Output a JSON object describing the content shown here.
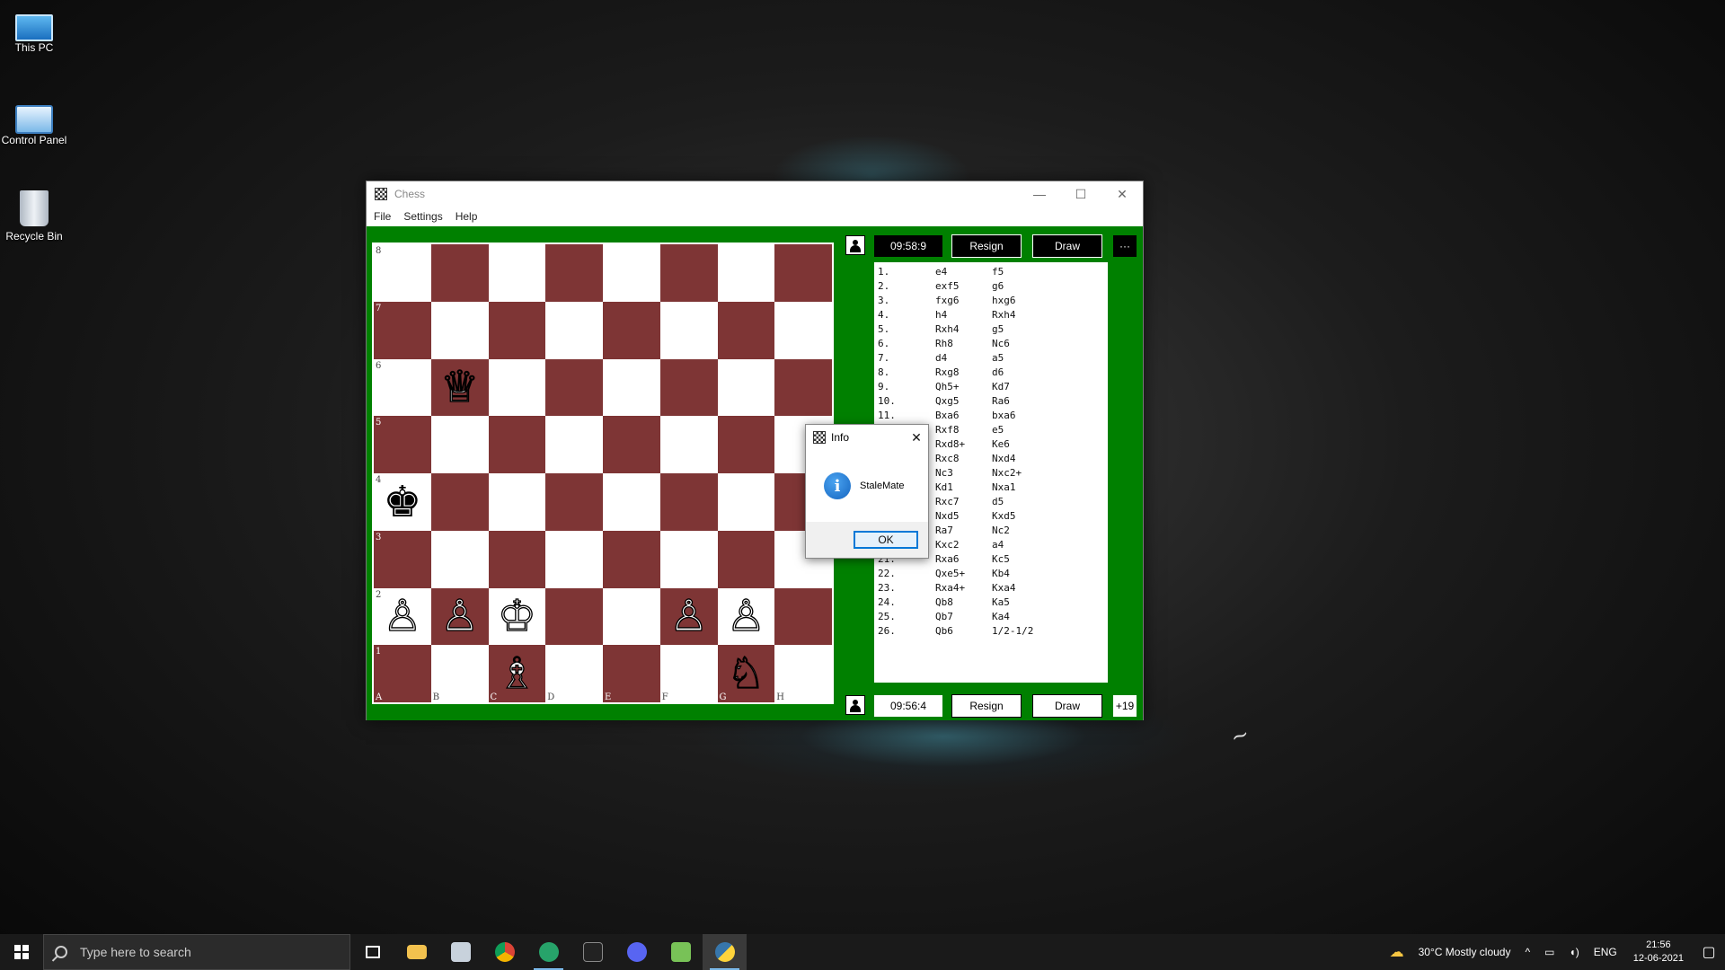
{
  "desktop": {
    "icons": [
      {
        "label": "This PC"
      },
      {
        "label": "Control Panel"
      },
      {
        "label": "Recycle Bin"
      }
    ]
  },
  "window": {
    "title": "Chess",
    "menu": [
      "File",
      "Settings",
      "Help"
    ]
  },
  "board": {
    "ranks": [
      "8",
      "7",
      "6",
      "5",
      "4",
      "3",
      "2",
      "1"
    ],
    "files": [
      "A",
      "B",
      "C",
      "D",
      "E",
      "F",
      "G",
      "H"
    ],
    "colors": {
      "light": "#ffffff",
      "dark": "#7e3535",
      "background": "#008000"
    },
    "pieces": {
      "b6": {
        "glyph": "♕",
        "color": "white",
        "name": "queen"
      },
      "a4": {
        "glyph": "♚",
        "color": "black",
        "name": "king"
      },
      "a2": {
        "glyph": "♙",
        "color": "white",
        "name": "pawn"
      },
      "b2": {
        "glyph": "♙",
        "color": "white",
        "name": "pawn"
      },
      "c2": {
        "glyph": "♔",
        "color": "white",
        "name": "king"
      },
      "f2": {
        "glyph": "♙",
        "color": "white",
        "name": "pawn"
      },
      "g2": {
        "glyph": "♙",
        "color": "white",
        "name": "pawn"
      },
      "c1": {
        "glyph": "♗",
        "color": "white",
        "name": "bishop"
      },
      "g1": {
        "glyph": "♘",
        "color": "white",
        "name": "knight"
      }
    }
  },
  "top_player": {
    "clock": "09:58:9",
    "resign_label": "Resign",
    "draw_label": "Draw",
    "more_label": "···"
  },
  "bottom_player": {
    "clock": "09:56:4",
    "resign_label": "Resign",
    "draw_label": "Draw",
    "material_label": "+19"
  },
  "moves": [
    [
      "1.",
      "e4",
      "f5"
    ],
    [
      "2.",
      "exf5",
      "g6"
    ],
    [
      "3.",
      "fxg6",
      "hxg6"
    ],
    [
      "4.",
      "h4",
      "Rxh4"
    ],
    [
      "5.",
      "Rxh4",
      "g5"
    ],
    [
      "6.",
      "Rh8",
      "Nc6"
    ],
    [
      "7.",
      "d4",
      "a5"
    ],
    [
      "8.",
      "Rxg8",
      "d6"
    ],
    [
      "9.",
      "Qh5+",
      "Kd7"
    ],
    [
      "10.",
      "Qxg5",
      "Ra6"
    ],
    [
      "11.",
      "Bxa6",
      "bxa6"
    ],
    [
      "12.",
      "Rxf8",
      "e5"
    ],
    [
      "13.",
      "Rxd8+",
      "Ke6"
    ],
    [
      "14.",
      "Rxc8",
      "Nxd4"
    ],
    [
      "15.",
      "Nc3",
      "Nxc2+"
    ],
    [
      "16.",
      "Kd1",
      "Nxa1"
    ],
    [
      "17.",
      "Rxc7",
      "d5"
    ],
    [
      "18.",
      "Nxd5",
      "Kxd5"
    ],
    [
      "19.",
      "Ra7",
      "Nc2"
    ],
    [
      "20.",
      "Kxc2",
      "a4"
    ],
    [
      "21.",
      "Rxa6",
      "Kc5"
    ],
    [
      "22.",
      "Qxe5+",
      "Kb4"
    ],
    [
      "23.",
      "Rxa4+",
      "Kxa4"
    ],
    [
      "24.",
      "Qb8",
      "Ka5"
    ],
    [
      "25.",
      "Qb7",
      "Ka4"
    ],
    [
      "26.",
      "Qb6",
      "1/2-1/2"
    ]
  ],
  "dialog": {
    "title": "Info",
    "message": "StaleMate",
    "ok_label": "OK"
  },
  "taskbar": {
    "search_placeholder": "Type here to search",
    "weather": "30°C  Mostly cloudy",
    "language": "ENG",
    "time": "21:56",
    "date": "12-06-2021",
    "apps": [
      "task-view",
      "file-explorer",
      "mail",
      "chrome",
      "vscode-like",
      "terminal",
      "discord",
      "android-studio",
      "python"
    ]
  }
}
